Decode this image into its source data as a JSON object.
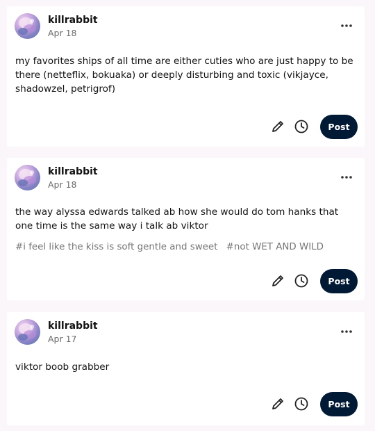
{
  "posts": [
    {
      "username": "killrabbit",
      "date": "Apr 18",
      "text": "my favorites ships of all time are either cuties who are just happy to be there (netteflix, bokuaka) or deeply disturbing and toxic (vikjayce, shadowzel, petrigrof)",
      "tags": [],
      "post_label": "Post"
    },
    {
      "username": "killrabbit",
      "date": "Apr 18",
      "text": "the way alyssa edwards talked ab how she would do tom hanks that one time is the same way i talk ab viktor",
      "tags": [
        "#i feel like the kiss is soft gentle and sweet",
        "#not WET AND WILD"
      ],
      "post_label": "Post"
    },
    {
      "username": "killrabbit",
      "date": "Apr 17",
      "text": "viktor boob grabber",
      "tags": [],
      "post_label": "Post"
    }
  ],
  "icons": {
    "avatar": "avatar-image",
    "more": "more-options-icon",
    "edit": "pencil-icon",
    "queue": "clock-icon"
  },
  "colors": {
    "background": "#fbf6fa",
    "card": "#ffffff",
    "post_button": "#001935",
    "muted_text": "#767676"
  }
}
